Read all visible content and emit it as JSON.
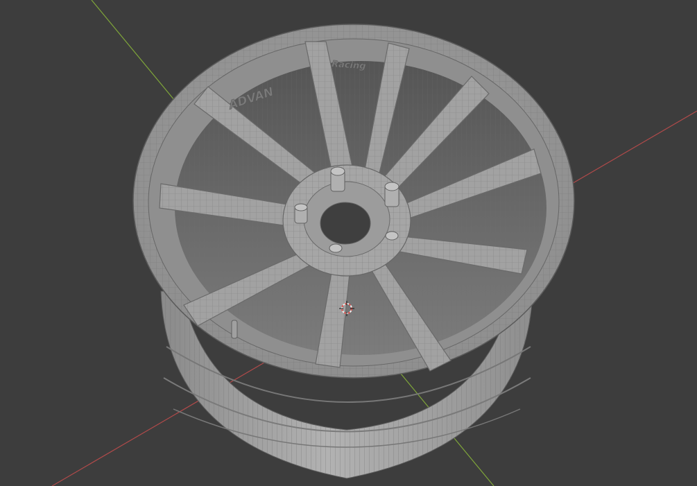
{
  "viewport": {
    "background": "#3d3d3d",
    "axis_x_color": "#b04a4a",
    "axis_y_color": "#7fa63a",
    "wireframe_color": "#6d6d6d",
    "surface_color": "#9b9b9b"
  },
  "model": {
    "name": "wheel",
    "brand_emboss": "ADVAN",
    "sub_emboss": "Racing",
    "spokes": 10,
    "lug_studs": 5
  },
  "cursor_3d": {
    "icon": "3d-cursor-icon"
  }
}
